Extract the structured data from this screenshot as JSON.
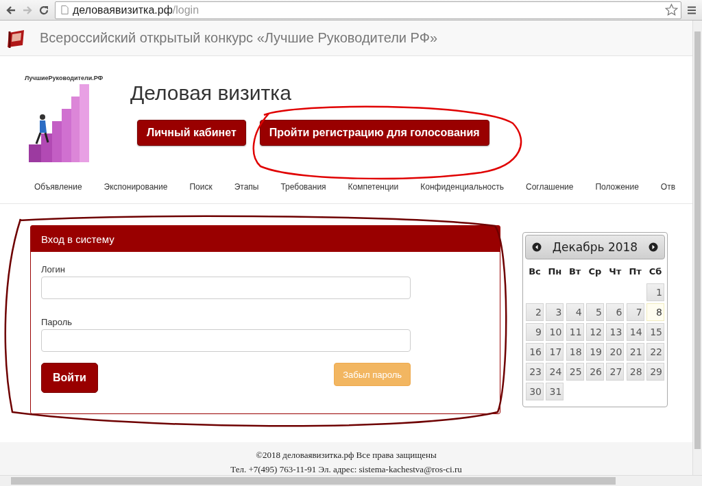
{
  "browser": {
    "back": {
      "disabled": false
    },
    "forward": {
      "disabled": true
    },
    "url": {
      "host": "деловаявизитка.рф",
      "path": "/login"
    }
  },
  "header": {
    "title": "Всероссийский открытый конкурс «Лучшие Руководители РФ»"
  },
  "brand": {
    "logo_caption": "ЛучшиеРуководители.РФ",
    "title": "Деловая визитка",
    "buttons": [
      "Личный кабинет",
      "Пройти регистрацию для голосования"
    ]
  },
  "nav": [
    "Объявление",
    "Экспонирование",
    "Поиск",
    "Этапы",
    "Требования",
    "Компетенции",
    "Конфиденциальность",
    "Соглашение",
    "Положение",
    "Отв"
  ],
  "login": {
    "title": "Вход в систему",
    "fields": [
      {
        "label": "Логин"
      },
      {
        "label": "Пароль"
      }
    ],
    "submit": "Войти",
    "forgot": "Забыл пароль"
  },
  "calendar": {
    "month": "Декабрь 2018",
    "weekdays": [
      "Вс",
      "Пн",
      "Вт",
      "Ср",
      "Чт",
      "Пт",
      "Сб"
    ],
    "weeks": [
      [
        {
          "kind": "empty"
        },
        {
          "kind": "empty"
        },
        {
          "kind": "empty"
        },
        {
          "kind": "empty"
        },
        {
          "kind": "empty"
        },
        {
          "kind": "empty"
        },
        {
          "kind": "day",
          "label": "1",
          "today": false
        }
      ],
      [
        {
          "kind": "day",
          "label": "2",
          "today": false
        },
        {
          "kind": "day",
          "label": "3",
          "today": false
        },
        {
          "kind": "day",
          "label": "4",
          "today": false
        },
        {
          "kind": "day",
          "label": "5",
          "today": false
        },
        {
          "kind": "day",
          "label": "6",
          "today": false
        },
        {
          "kind": "day",
          "label": "7",
          "today": false
        },
        {
          "kind": "day",
          "label": "8",
          "today": true
        }
      ],
      [
        {
          "kind": "day",
          "label": "9",
          "today": false
        },
        {
          "kind": "day",
          "label": "10",
          "today": false
        },
        {
          "kind": "day",
          "label": "11",
          "today": false
        },
        {
          "kind": "day",
          "label": "12",
          "today": false
        },
        {
          "kind": "day",
          "label": "13",
          "today": false
        },
        {
          "kind": "day",
          "label": "14",
          "today": false
        },
        {
          "kind": "day",
          "label": "15",
          "today": false
        }
      ],
      [
        {
          "kind": "day",
          "label": "16",
          "today": false
        },
        {
          "kind": "day",
          "label": "17",
          "today": false
        },
        {
          "kind": "day",
          "label": "18",
          "today": false
        },
        {
          "kind": "day",
          "label": "19",
          "today": false
        },
        {
          "kind": "day",
          "label": "20",
          "today": false
        },
        {
          "kind": "day",
          "label": "21",
          "today": false
        },
        {
          "kind": "day",
          "label": "22",
          "today": false
        }
      ],
      [
        {
          "kind": "day",
          "label": "23",
          "today": false
        },
        {
          "kind": "day",
          "label": "24",
          "today": false
        },
        {
          "kind": "day",
          "label": "25",
          "today": false
        },
        {
          "kind": "day",
          "label": "26",
          "today": false
        },
        {
          "kind": "day",
          "label": "27",
          "today": false
        },
        {
          "kind": "day",
          "label": "28",
          "today": false
        },
        {
          "kind": "day",
          "label": "29",
          "today": false
        }
      ],
      [
        {
          "kind": "day",
          "label": "30",
          "today": false
        },
        {
          "kind": "day",
          "label": "31",
          "today": false
        },
        {
          "kind": "empty"
        },
        {
          "kind": "empty"
        },
        {
          "kind": "empty"
        },
        {
          "kind": "empty"
        },
        {
          "kind": "empty"
        }
      ]
    ]
  },
  "footer": [
    "©2018 деловаявизитка.рф Все права защищены",
    "Тел. +7(495) 763-11-91 Эл. адрес: sistema-kachestva@ros-ci.ru"
  ]
}
